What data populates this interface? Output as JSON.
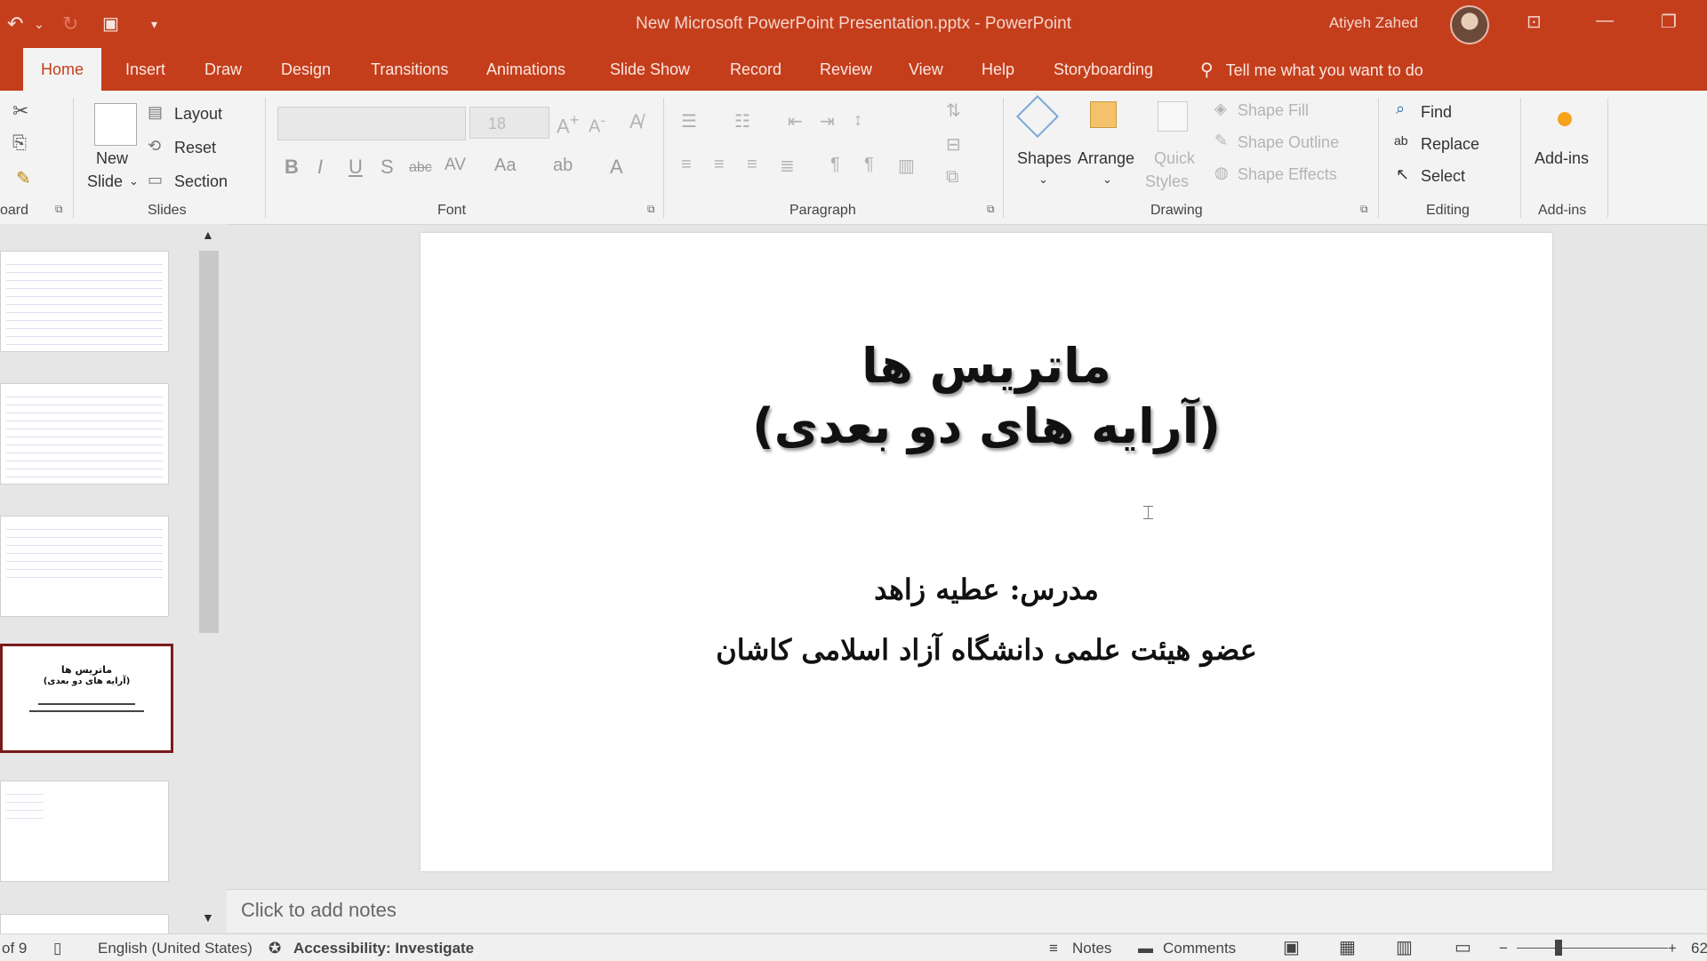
{
  "window": {
    "title": "New Microsoft PowerPoint Presentation.pptx  -  PowerPoint",
    "user_name": "Atiyeh Zahed"
  },
  "tabs": [
    "Home",
    "Insert",
    "Draw",
    "Design",
    "Transitions",
    "Animations",
    "Slide Show",
    "Record",
    "Review",
    "View",
    "Help",
    "Storyboarding"
  ],
  "tell_me": "Tell me what you want to do",
  "ribbon": {
    "clipboard_label": "oard",
    "slides": {
      "new_slide_1": "New",
      "new_slide_2": "Slide",
      "layout": "Layout",
      "reset": "Reset",
      "section": "Section",
      "label": "Slides"
    },
    "font": {
      "size": "18",
      "label": "Font"
    },
    "paragraph": {
      "label": "Paragraph"
    },
    "drawing": {
      "shapes": "Shapes",
      "arrange": "Arrange",
      "quick": "Quick",
      "styles": "Styles",
      "shape_fill": "Shape Fill",
      "shape_outline": "Shape Outline",
      "shape_effects": "Shape Effects",
      "label": "Drawing"
    },
    "editing": {
      "find": "Find",
      "replace": "Replace",
      "select": "Select",
      "label": "Editing"
    },
    "addins": {
      "button": "Add-ins",
      "label": "Add-ins"
    }
  },
  "slide": {
    "title_line1": "ماتریس ها",
    "title_line2": "(آرایه های دو بعدی)",
    "subtitle_line1": "مدرس: عطیه زاهد",
    "subtitle_line2": "عضو هیئت علمی دانشگاه آزاد اسلامی کاشان"
  },
  "thumb_selected": {
    "line1": "ماتریس ها",
    "line2": "(آرایه های دو بعدی)"
  },
  "notes_placeholder": "Click to add notes",
  "status": {
    "slide_of": "of 9",
    "language": "English (United States)",
    "accessibility": "Accessibility: Investigate",
    "notes": "Notes",
    "comments": "Comments",
    "zoom": "62"
  },
  "colors": {
    "accent": "#c43e1c",
    "selected_thumb_border": "#7a1b1b"
  }
}
